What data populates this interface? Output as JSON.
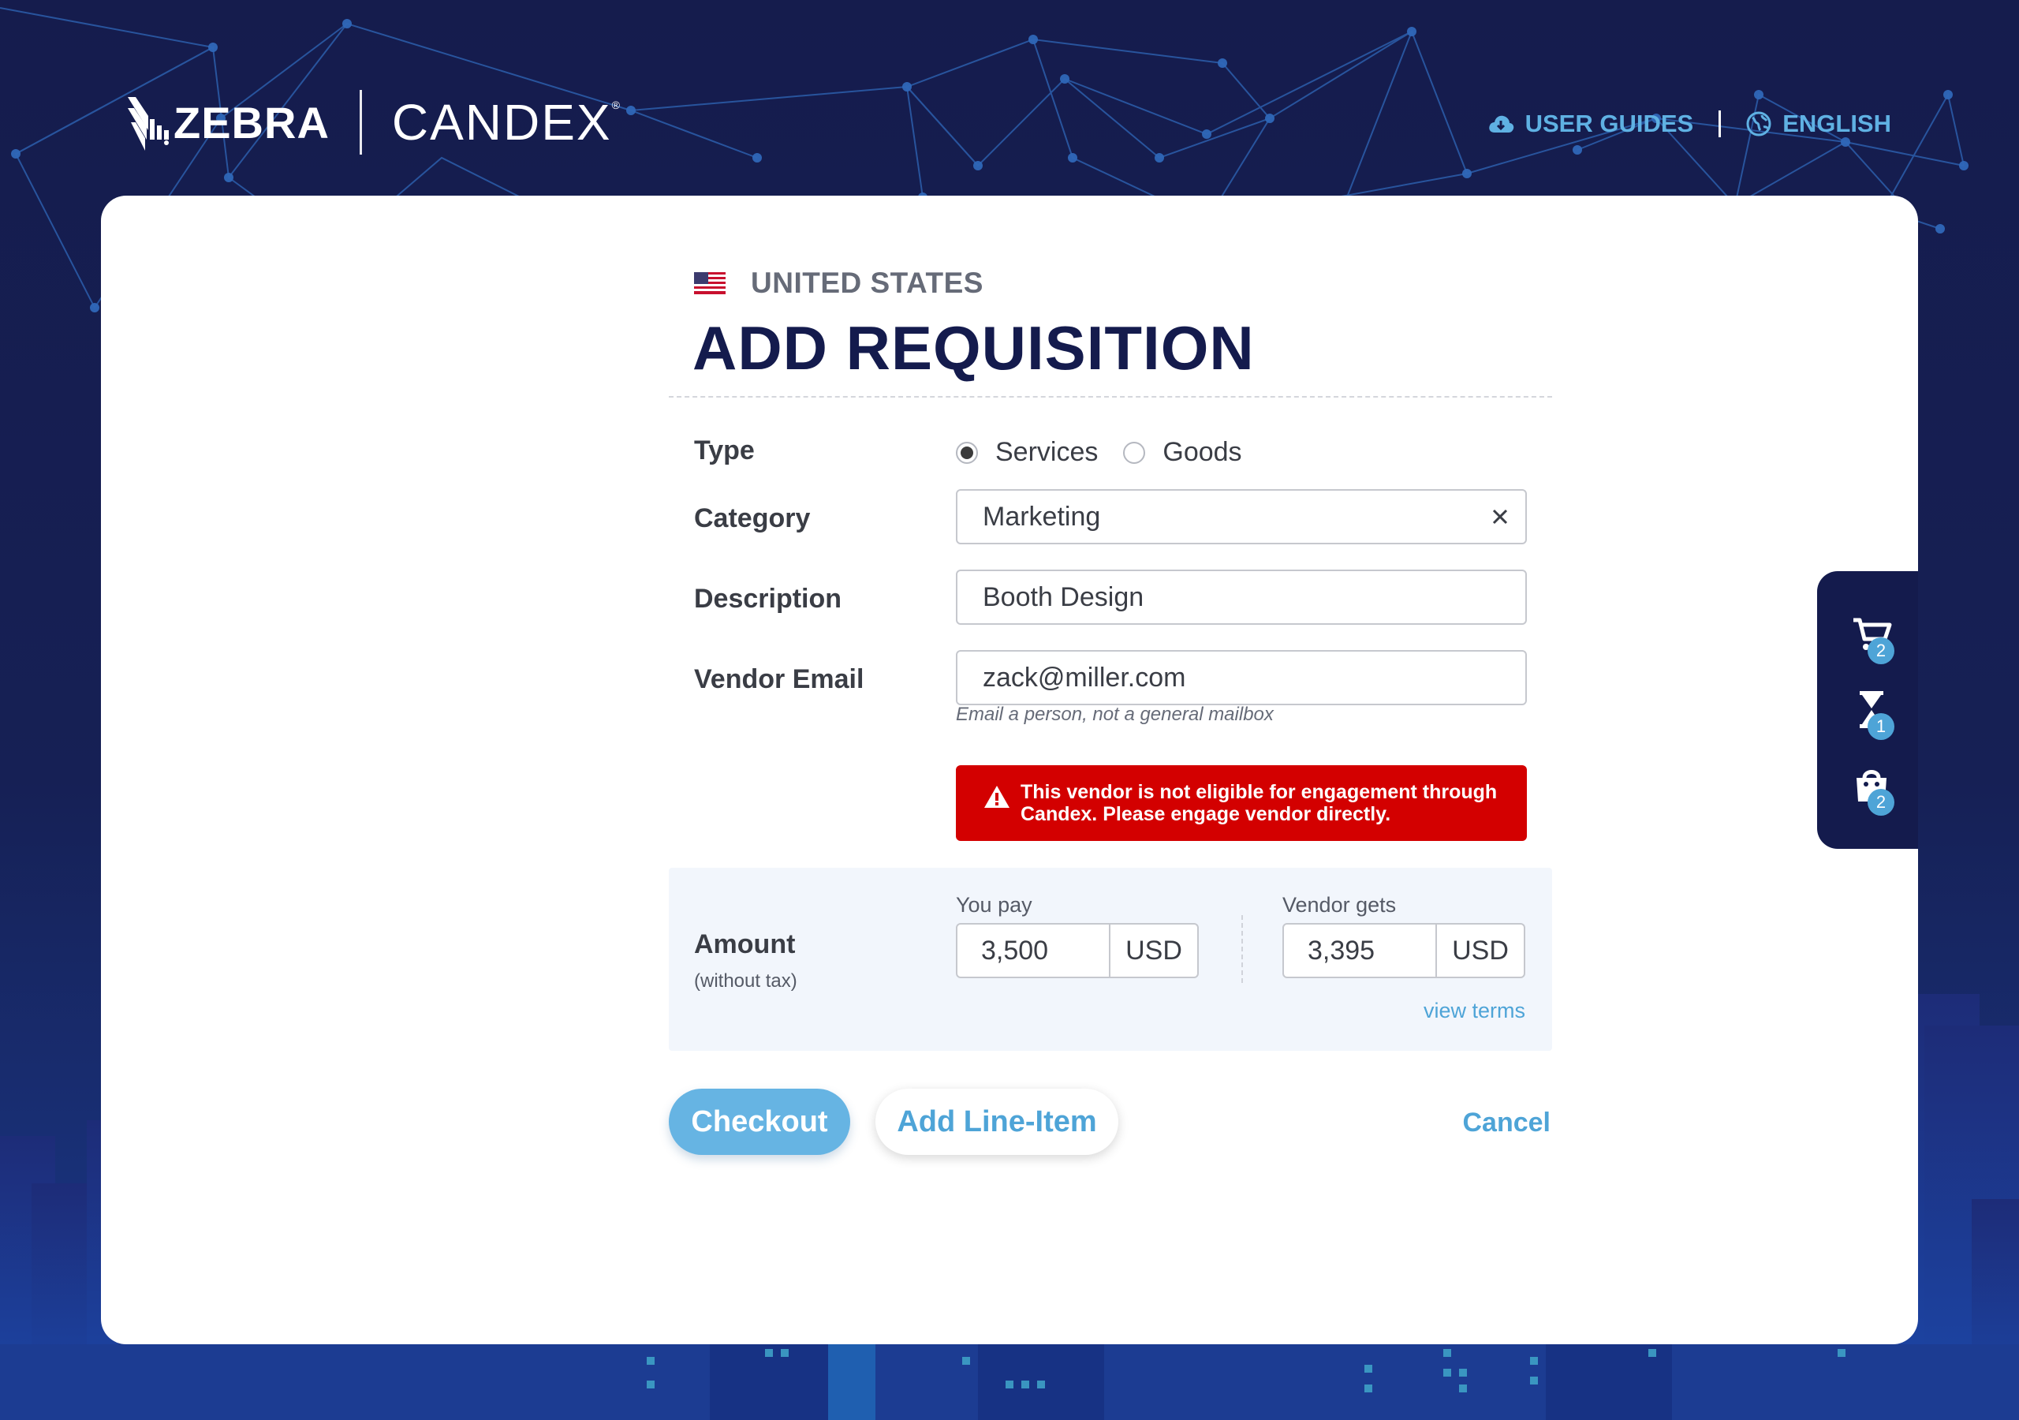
{
  "brand": {
    "partner": "ZEBRA",
    "product": "CANDEX",
    "registered": "®"
  },
  "topnav": {
    "user_guides": "USER GUIDES",
    "language": "ENGLISH"
  },
  "form": {
    "country": "UNITED STATES",
    "title": "ADD REQUISITION",
    "type": {
      "label": "Type",
      "options": [
        "Services",
        "Goods"
      ],
      "selected": "Services"
    },
    "category": {
      "label": "Category",
      "value": "Marketing"
    },
    "description": {
      "label": "Description",
      "value": "Booth Design"
    },
    "vendor_email": {
      "label": "Vendor Email",
      "value": "zack@miller.com",
      "hint": "Email a person, not a general mailbox"
    },
    "error": "This vendor is not eligible for engagement through Candex. Please engage vendor directly.",
    "amount": {
      "label": "Amount",
      "sublabel": "(without tax)",
      "you_pay": {
        "caption": "You pay",
        "value": "3,500",
        "currency": "USD"
      },
      "vendor_gets": {
        "caption": "Vendor gets",
        "value": "3,395",
        "currency": "USD"
      },
      "terms_link": "view terms"
    },
    "actions": {
      "checkout": "Checkout",
      "add_line_item": "Add Line-Item",
      "cancel": "Cancel"
    }
  },
  "dock": {
    "cart_count": "2",
    "pending_count": "1",
    "orders_count": "2"
  },
  "colors": {
    "navy": "#141b4d",
    "accent": "#66b4e3",
    "link": "#4ea4d7",
    "error": "#d30000"
  }
}
